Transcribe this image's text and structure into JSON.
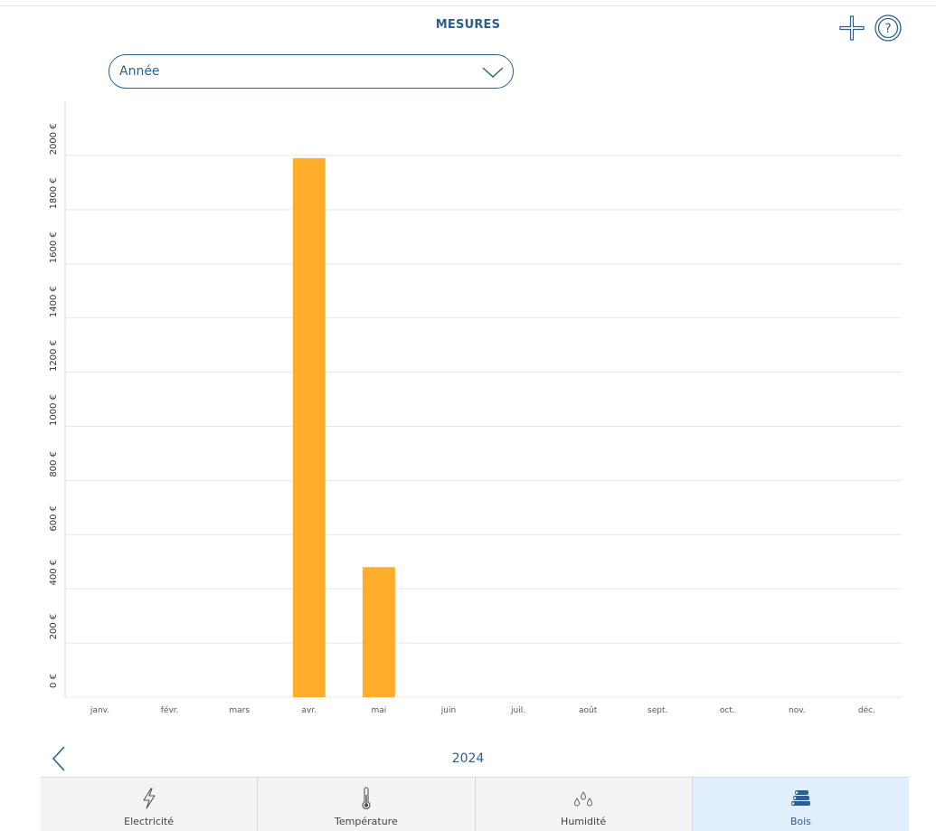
{
  "header": {
    "title": "MESURES",
    "add_icon": "plus-icon",
    "help_icon": "question-circle-icon"
  },
  "period_select": {
    "value": "Année",
    "icon": "chevron-down-icon"
  },
  "chart_data": {
    "type": "bar",
    "categories": [
      "janv.",
      "févr.",
      "mars",
      "avr.",
      "mai",
      "juin",
      "juil.",
      "août",
      "sept.",
      "oct.",
      "nov.",
      "déc."
    ],
    "values": [
      0,
      0,
      0,
      1990,
      480,
      0,
      0,
      0,
      0,
      0,
      0,
      0
    ],
    "yticks": [
      "0 €",
      "200 €",
      "400 €",
      "600 €",
      "800 €",
      "1000 €",
      "1200 €",
      "1400 €",
      "1600 €",
      "1800 €",
      "2000 €"
    ],
    "ylim": [
      0,
      2200
    ],
    "grid": true,
    "bar_color": "#ffad2b"
  },
  "pager": {
    "year": "2024",
    "prev_icon": "chevron-left-icon"
  },
  "tabs": [
    {
      "label": "Electricité",
      "icon": "lightning-icon"
    },
    {
      "label": "Température",
      "icon": "thermometer-icon"
    },
    {
      "label": "Humidité",
      "icon": "droplets-icon"
    },
    {
      "label": "Bois",
      "icon": "firewood-icon"
    }
  ],
  "colors": {
    "accent": "#2a5f8f",
    "active_tab": "#e1eefb"
  }
}
